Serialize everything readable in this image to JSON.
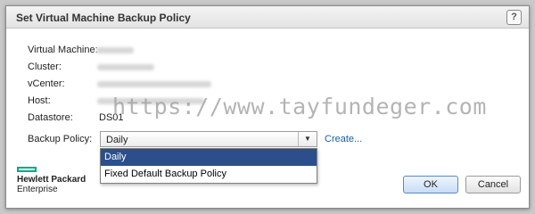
{
  "dialog": {
    "title": "Set Virtual Machine Backup Policy",
    "help_glyph": "?"
  },
  "fields": {
    "virtual_machine_label": "Virtual Machine:",
    "cluster_label": "Cluster:",
    "vcenter_label": "vCenter:",
    "host_label": "Host:",
    "datastore_label": "Datastore:",
    "datastore_value": "DS01",
    "backup_policy_label": "Backup Policy:"
  },
  "backup_policy": {
    "selected": "Daily",
    "options": [
      "Daily",
      "Fixed Default Backup Policy"
    ],
    "create_link": "Create..."
  },
  "watermark": "https://www.tayfundeger.com",
  "branding": {
    "line1": "Hewlett Packard",
    "line2": "Enterprise",
    "accent_color": "#01a982"
  },
  "buttons": {
    "ok": "OK",
    "cancel": "Cancel"
  },
  "colors": {
    "selection": "#2c4f8c",
    "link": "#1b5fa8"
  }
}
